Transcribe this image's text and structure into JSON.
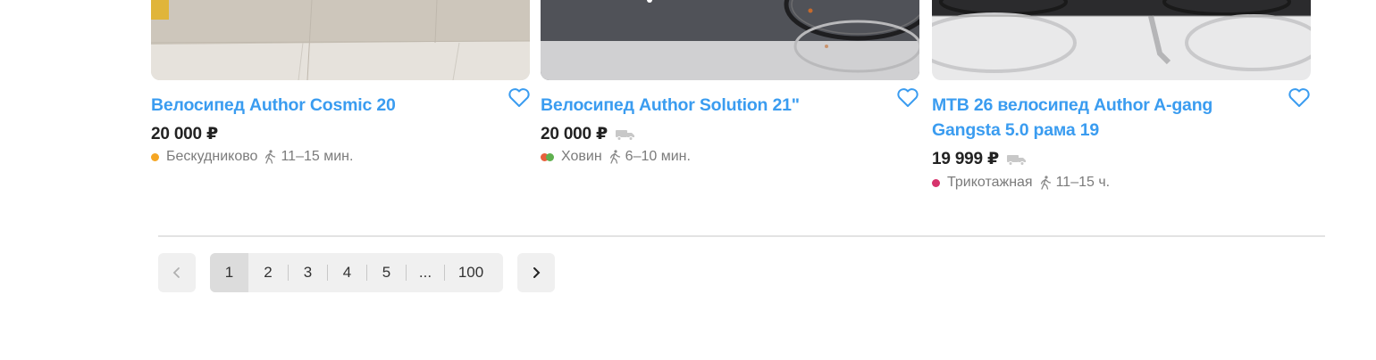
{
  "products": [
    {
      "title": "Велосипед Author Cosmic 20",
      "price": "20 000 ₽",
      "delivery": false,
      "metro_station": "Бескудниково",
      "metro_color": "#f5a623",
      "walk_time": "11–15 мин."
    },
    {
      "title": "Велосипед Author Solution 21\"",
      "price": "20 000 ₽",
      "delivery": true,
      "metro_station": "Ховин",
      "metro_color": "#e8603c",
      "metro_color_2": "#5fb04f",
      "walk_time": "6–10 мин."
    },
    {
      "title": "МТВ 26 велосипед Author A-gang Gangsta 5.0 рама 19",
      "price": "19 999 ₽",
      "delivery": true,
      "metro_station": "Трикотажная",
      "metro_color": "#d6336c",
      "walk_time": "11–15 ч."
    }
  ],
  "pagination": {
    "pages": [
      "1",
      "2",
      "3",
      "4",
      "5",
      "...",
      "100"
    ],
    "current": "1"
  },
  "colors": {
    "link": "#3a9cf0",
    "accent": "#3a9cf0"
  }
}
